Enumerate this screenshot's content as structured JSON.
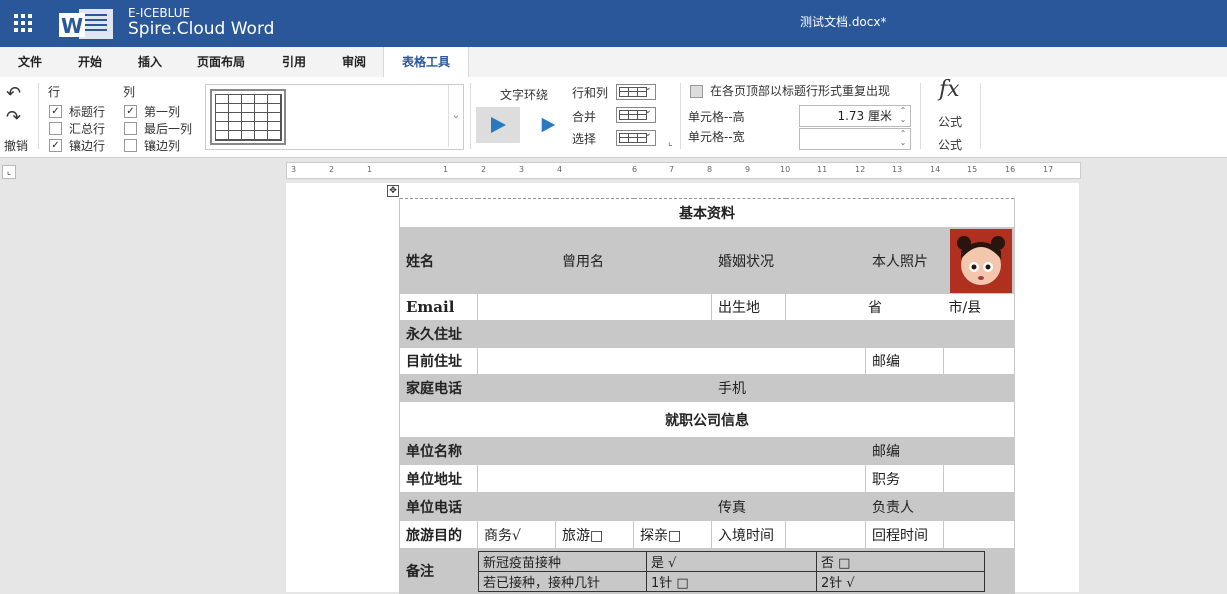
{
  "titlebar": {
    "brand_top": "E-ICEBLUE",
    "brand_main": "Spire.Cloud Word",
    "doc_title": "测试文档.docx*",
    "apps_icon": "grid-icon",
    "logo_icon": "word-logo-icon"
  },
  "menu": {
    "tabs": [
      "文件",
      "开始",
      "插入",
      "页面布局",
      "引用",
      "审阅",
      "表格工具"
    ],
    "active": "表格工具"
  },
  "ribbon": {
    "undo_label": "撤销",
    "row_group": "行",
    "col_group": "列",
    "header_row": "标题行",
    "total_row": "汇总行",
    "banded_row": "镶边行",
    "first_col": "第一列",
    "last_col": "最后一列",
    "banded_col": "镶边列",
    "checks": {
      "header_row": true,
      "total_row": false,
      "banded_row": true,
      "first_col": true,
      "last_col": false,
      "banded_col": false
    },
    "text_wrap": "文字环绕",
    "rows_cols": "行和列",
    "merge": "合并",
    "select": "选择",
    "repeat_header": "在各页顶部以标题行形式重复出现",
    "cell_height_label": "单元格--高",
    "cell_height_value": "1.73 厘米",
    "cell_width_label": "单元格--宽",
    "cell_width_value": "",
    "formula_symbol": "fx",
    "formula_label": "公式",
    "formula_group": "公式"
  },
  "ruler": {
    "ticks": [
      "3",
      "2",
      "1",
      "1",
      "2",
      "3",
      "4",
      "6",
      "7",
      "8",
      "9",
      "10",
      "11",
      "12",
      "13",
      "14",
      "15",
      "16",
      "17"
    ]
  },
  "doc": {
    "basic_title": "基本资料",
    "name": "姓名",
    "former_name": "曾用名",
    "marital": "婚姻状况",
    "photo": "本人照片",
    "email": "Email",
    "birthplace": "出生地",
    "province": "省",
    "city": "市/县",
    "perm_addr": "永久住址",
    "curr_addr": "目前住址",
    "postcode": "邮编",
    "home_phone": "家庭电话",
    "mobile": "手机",
    "company_title": "就职公司信息",
    "company_name": "单位名称",
    "postcode2": "邮编",
    "company_addr": "单位地址",
    "position": "职务",
    "company_phone": "单位电话",
    "fax": "传真",
    "manager": "负责人",
    "travel": "旅游目的",
    "business": "商务√",
    "tourism": "旅游□",
    "visit": "探亲□",
    "entry_time": "入境时间",
    "return_time": "回程时间",
    "remarks": "备注",
    "vaccine": "新冠疫苗接种",
    "yes": "是 √",
    "no": "否 □",
    "doses_q": "若已接种，接种几针",
    "one_dose": "1针 □",
    "two_dose": "2针 √"
  }
}
